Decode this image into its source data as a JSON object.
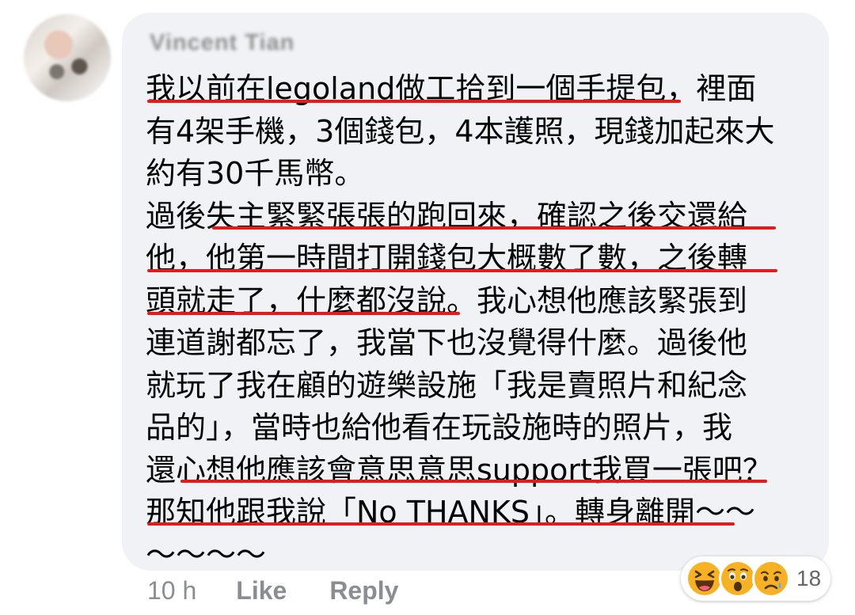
{
  "comment": {
    "author": "Vincent Tian",
    "text": "我以前在legoland做工拾到一個手提包，裡面有4架手機，3個錢包，4本護照，現錢加起來大約有30千馬幣。過後失主緊緊張張的跑回來，確認之後交還給他，他第一時間打開錢包大概數了數，之後轉頭就走了，什麼都沒說。我心想他應該緊張到連道謝都忘了，我當下也沒覺得什麼。過後他就玩了我在顧的遊樂設施「我是賣照片和紀念品的」，當時也給他看在玩設施時的照片，我還心想他應該會意思意思support我買一張吧？那知他跟我說「No THANKS」。轉身離開～～～～～～",
    "lines": [
      "我以前在legoland做工拾到一個手提包，裡面",
      "有4架手機，3個錢包，4本護照，現錢加起來大",
      "約有30千馬幣。",
      "過後失主緊緊張張的跑回來，確認之後交還給",
      "他，他第一時間打開錢包大概數了數，之後轉",
      "頭就走了，什麼都沒說。我心想他應該緊張到",
      "連道謝都忘了，我當下也沒覺得什麼。過後他",
      "就玩了我在顧的遊樂設施「我是賣照片和紀念",
      "品的」，當時也給他看在玩設施時的照片，我",
      "還心想他應該會意思意思support我買一張吧？",
      "那知他跟我說「No THANKS」。轉身離開～～",
      "～～～～"
    ]
  },
  "actions": {
    "time": "10 h",
    "like": "Like",
    "reply": "Reply"
  },
  "reactions": {
    "icons": [
      "laughing-emoji",
      "surprised-emoji",
      "sad-emoji"
    ],
    "count": "18"
  },
  "colors": {
    "bubble": "#f0f2f5",
    "underline": "#e21b1b",
    "muted_text": "#8a8d91"
  }
}
